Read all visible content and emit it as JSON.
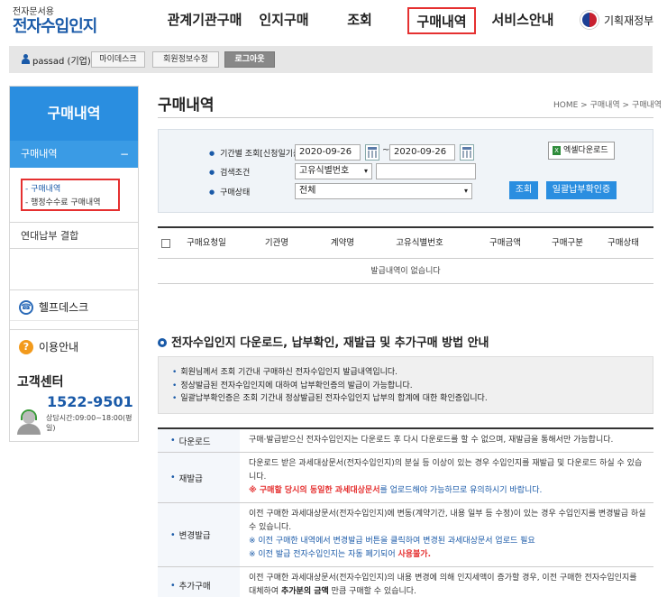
{
  "header": {
    "logo_sub": "전자문서용",
    "logo_main": "전자수입인지",
    "nav": [
      "관계기관구매",
      "인지구매",
      "조회",
      "구매내역",
      "서비스안내"
    ],
    "gov_name": "기획재정부"
  },
  "userbar": {
    "user_name": "passad (기업)",
    "mydesk": "마이데스크",
    "edit_profile": "회원정보수정",
    "logout": "로그아웃"
  },
  "sidebar": {
    "title": "구매내역",
    "item1": "구매내역",
    "item1_toggle": "−",
    "sub": [
      "- 구매내역",
      "- 행정수수료 구매내역"
    ],
    "item2": "연대납부 결합",
    "helpdesk": "헬프데스크",
    "guide": "이용안내",
    "cs_title": "고객센터",
    "cs_phone": "1522-9501",
    "cs_hours": "상담시간:09:00~18:00(평일)"
  },
  "main": {
    "title": "구매내역",
    "breadcrumb": "HOME > 구매내역 > 구매내역",
    "search": {
      "period_label": "기간별 조회[신청일기준]",
      "date_from": "2020-09-26",
      "tilde": "~",
      "date_to": "2020-09-26",
      "condition_label": "검색조건",
      "condition_value": "고유식별번호",
      "status_label": "구매상태",
      "status_value": "전체",
      "excel_button": "엑셀다운로드",
      "search_button": "조회",
      "confirm_button": "일괄납부확인증",
      "arrow": "▾"
    },
    "table": {
      "columns": [
        "구매요청일",
        "기관명",
        "계약명",
        "고유식별번호",
        "구매금액",
        "구매구분",
        "구매상태"
      ],
      "empty_text": "발급내역이 없습니다"
    },
    "section_title": "전자수입인지 다운로드, 납부확인, 재발급 및 추가구매 방법 안내",
    "info_lines": [
      "회원님께서 조회 기간내 구매하신 전자수입인지 발급내역입니다.",
      "정상발급된 전자수입인지에 대하여 납부확인증의 발급이 가능합니다.",
      "일괄납부확인증은 조회 기간내 정상발급된 전자수입인지 납부의 합계에 대한 확인증입니다."
    ],
    "desc": [
      {
        "label": "다운로드",
        "text": "구매·발급받으신 전자수입인지는 다운로드 후 다시 다운로드를 할 수 없으며, 재발급을 통해서만 가능합니다."
      },
      {
        "label": "재발급",
        "text": "다운로드 받은 과세대상문서(전자수입인지)의 분실 등 이상이 있는 경우 수입인지를 재발급 및 다운로드 하실 수 있습니다.",
        "note_pre": "※ 구매할 당시의 동일한 과세대상문서",
        "note_mid": "를 업로드해야 가능하므로 유의하시기 바랍니다."
      },
      {
        "label": "변경발급",
        "text": "이전 구매한 과세대상문서(전자수입인지)에 변동(계약기간, 내용 일부 등 수정)이 있는 경우 수입인지를 변경발급 하실 수 있습니다.",
        "note1": "※ 이전 구매한 내역에서 변경발급 버튼을 클릭하여 변경된 과세대상문서 업로드 필요",
        "note2_pre": "※ 이전 발급 전자수입인지는 자동 폐기되어 ",
        "note2_red": "사용불가."
      },
      {
        "label": "추가구매",
        "text_pre": "이전 구매한 과세대상문서(전자수입인지)의 내용 변경에 의해 인지세액이 증가할 경우, 이전 구매한 전자수입인지를 대체하여 ",
        "text_bold": "추가분의 금액",
        "text_post": " 만큼 구매할 수 있습니다."
      }
    ]
  },
  "colors": {
    "accent": "#2a8ee0",
    "brand": "#1a5aa8",
    "highlight": "#e53030"
  }
}
